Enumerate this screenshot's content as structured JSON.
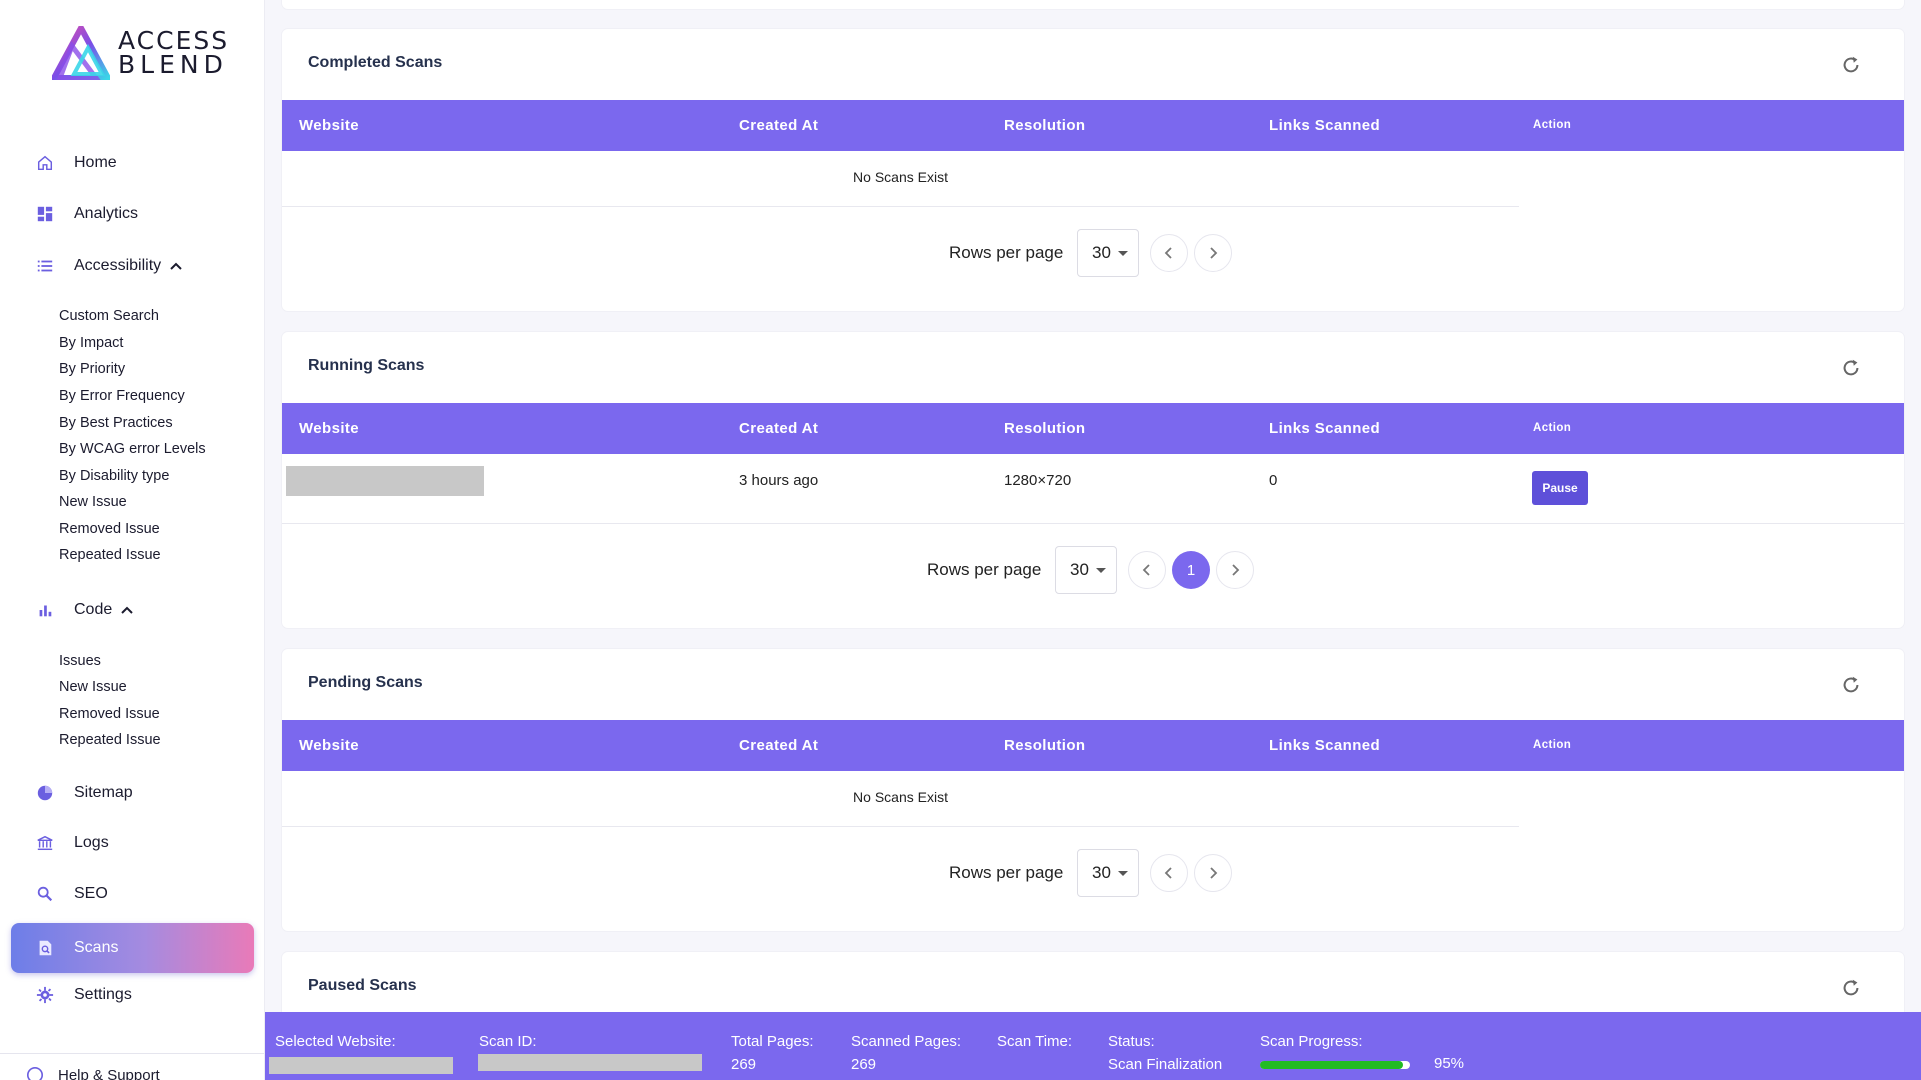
{
  "brand": {
    "line1": "ACCESS",
    "line2": "BLEND"
  },
  "sidebar": {
    "items": [
      {
        "label": "Home",
        "icon": "home-icon"
      },
      {
        "label": "Analytics",
        "icon": "dashboard-icon"
      },
      {
        "label": "Accessibility",
        "icon": "list-icon"
      },
      {
        "label": "Code",
        "icon": "bar-chart-icon"
      },
      {
        "label": "Sitemap",
        "icon": "pie-chart-icon"
      },
      {
        "label": "Logs",
        "icon": "bank-icon"
      },
      {
        "label": "SEO",
        "icon": "search-icon"
      },
      {
        "label": "Scans",
        "icon": "scan-icon"
      },
      {
        "label": "Settings",
        "icon": "gear-icon"
      }
    ],
    "accessibility_sub": [
      "Custom Search",
      "By Impact",
      "By Priority",
      "By Error Frequency",
      "By Best Practices",
      "By WCAG error Levels",
      "By Disability type",
      "New Issue",
      "Removed Issue",
      "Repeated Issue"
    ],
    "code_sub": [
      "Issues",
      "New Issue",
      "Removed Issue",
      "Repeated Issue"
    ],
    "help": "Help & Support"
  },
  "table_headers": {
    "website": "Website",
    "created_at": "Created At",
    "resolution": "Resolution",
    "links_scanned": "Links Scanned",
    "action": "Action"
  },
  "pager": {
    "rows_label": "Rows per page",
    "rows_value": "30"
  },
  "completed": {
    "title": "Completed Scans",
    "empty": "No Scans Exist"
  },
  "running": {
    "title": "Running Scans",
    "row": {
      "created_at": "3 hours ago",
      "resolution": "1280×720",
      "links_scanned": "0",
      "action": "Pause"
    },
    "page": "1"
  },
  "pending": {
    "title": "Pending Scans",
    "empty": "No Scans Exist"
  },
  "paused": {
    "title": "Paused Scans"
  },
  "status": {
    "selected_website_label": "Selected Website:",
    "scan_id_label": "Scan ID:",
    "total_pages_label": "Total Pages:",
    "total_pages": "269",
    "scanned_pages_label": "Scanned Pages:",
    "scanned_pages": "269",
    "scan_time_label": "Scan Time:",
    "status_label": "Status:",
    "status_value": "Scan Finalization",
    "progress_label": "Scan Progress:",
    "progress_percent": 95,
    "progress_text": "95%"
  },
  "colors": {
    "accent": "#7b68ee",
    "progress": "#22bb22",
    "pause_button": "#5e50d9"
  }
}
